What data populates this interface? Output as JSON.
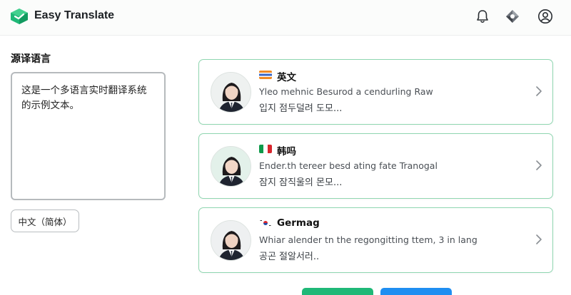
{
  "header": {
    "app_title": "Easy Translate",
    "icons": [
      "bell-icon",
      "translate-icon",
      "user-icon"
    ],
    "logo_color": "#1fb877"
  },
  "source": {
    "section_title": "源译语言",
    "text": "这是一个多语言实时翻译系统的示例文本。",
    "language_select": "中文（简体）"
  },
  "results": [
    {
      "language": "英文",
      "line1": "Yleo mehnic Besurod a cendurling Raw",
      "line2": "입지 점두덜려 도모..."
    },
    {
      "language": "韩吗",
      "line1": "Ender.th tereer besd ating fate Tranogal",
      "line2": "잠지 잠직울의 몬모..."
    },
    {
      "language": "Germag",
      "line1": "Whiar alender tn the regongitting ttem, 3 in lang",
      "line2": "공곤 절알서러.."
    }
  ],
  "colors": {
    "accent_green": "#1fb877",
    "card_border": "#8fd6b0",
    "primary_blue": "#1f8ef1"
  }
}
